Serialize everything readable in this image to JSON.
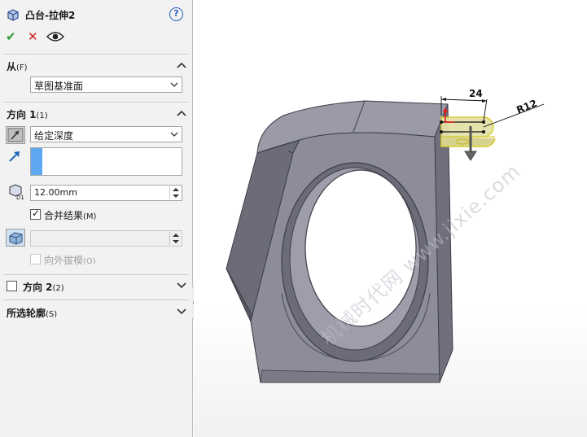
{
  "feature": {
    "title": "凸台-拉伸2",
    "help_symbol": "?",
    "icon": "boss-extrude-icon",
    "ok_symbol": "✔",
    "cancel_symbol": "✕"
  },
  "sections": {
    "from": {
      "title": "从",
      "shortcut": "(F)",
      "start_condition": "草图基准面",
      "expanded": true
    },
    "direction1": {
      "title": "方向 1",
      "shortcut": "(1)",
      "end_condition": "给定深度",
      "depth": "12.00mm",
      "merge_label": "合并结果",
      "merge_shortcut": "(M)",
      "merge_checked": true,
      "draft_outward_label": "向外拔模",
      "draft_outward_shortcut": "(O)",
      "draft_outward_enabled": false,
      "draft_angle": "",
      "expanded": true
    },
    "direction2": {
      "title": "方向 2",
      "shortcut": "(2)",
      "checked": false,
      "expanded": false
    },
    "contours": {
      "title": "所选轮廓",
      "shortcut": "(S)",
      "expanded": false
    }
  },
  "viewport": {
    "dimension_length": "24",
    "dimension_radius": "R12",
    "watermark": "机械时代网 www.jixie.com",
    "colors": {
      "body_face": "#8c8d99",
      "body_dark": "#5e5f6b",
      "preview_fill": "#e5e1a8",
      "preview_edge": "#d6cc2b"
    }
  }
}
